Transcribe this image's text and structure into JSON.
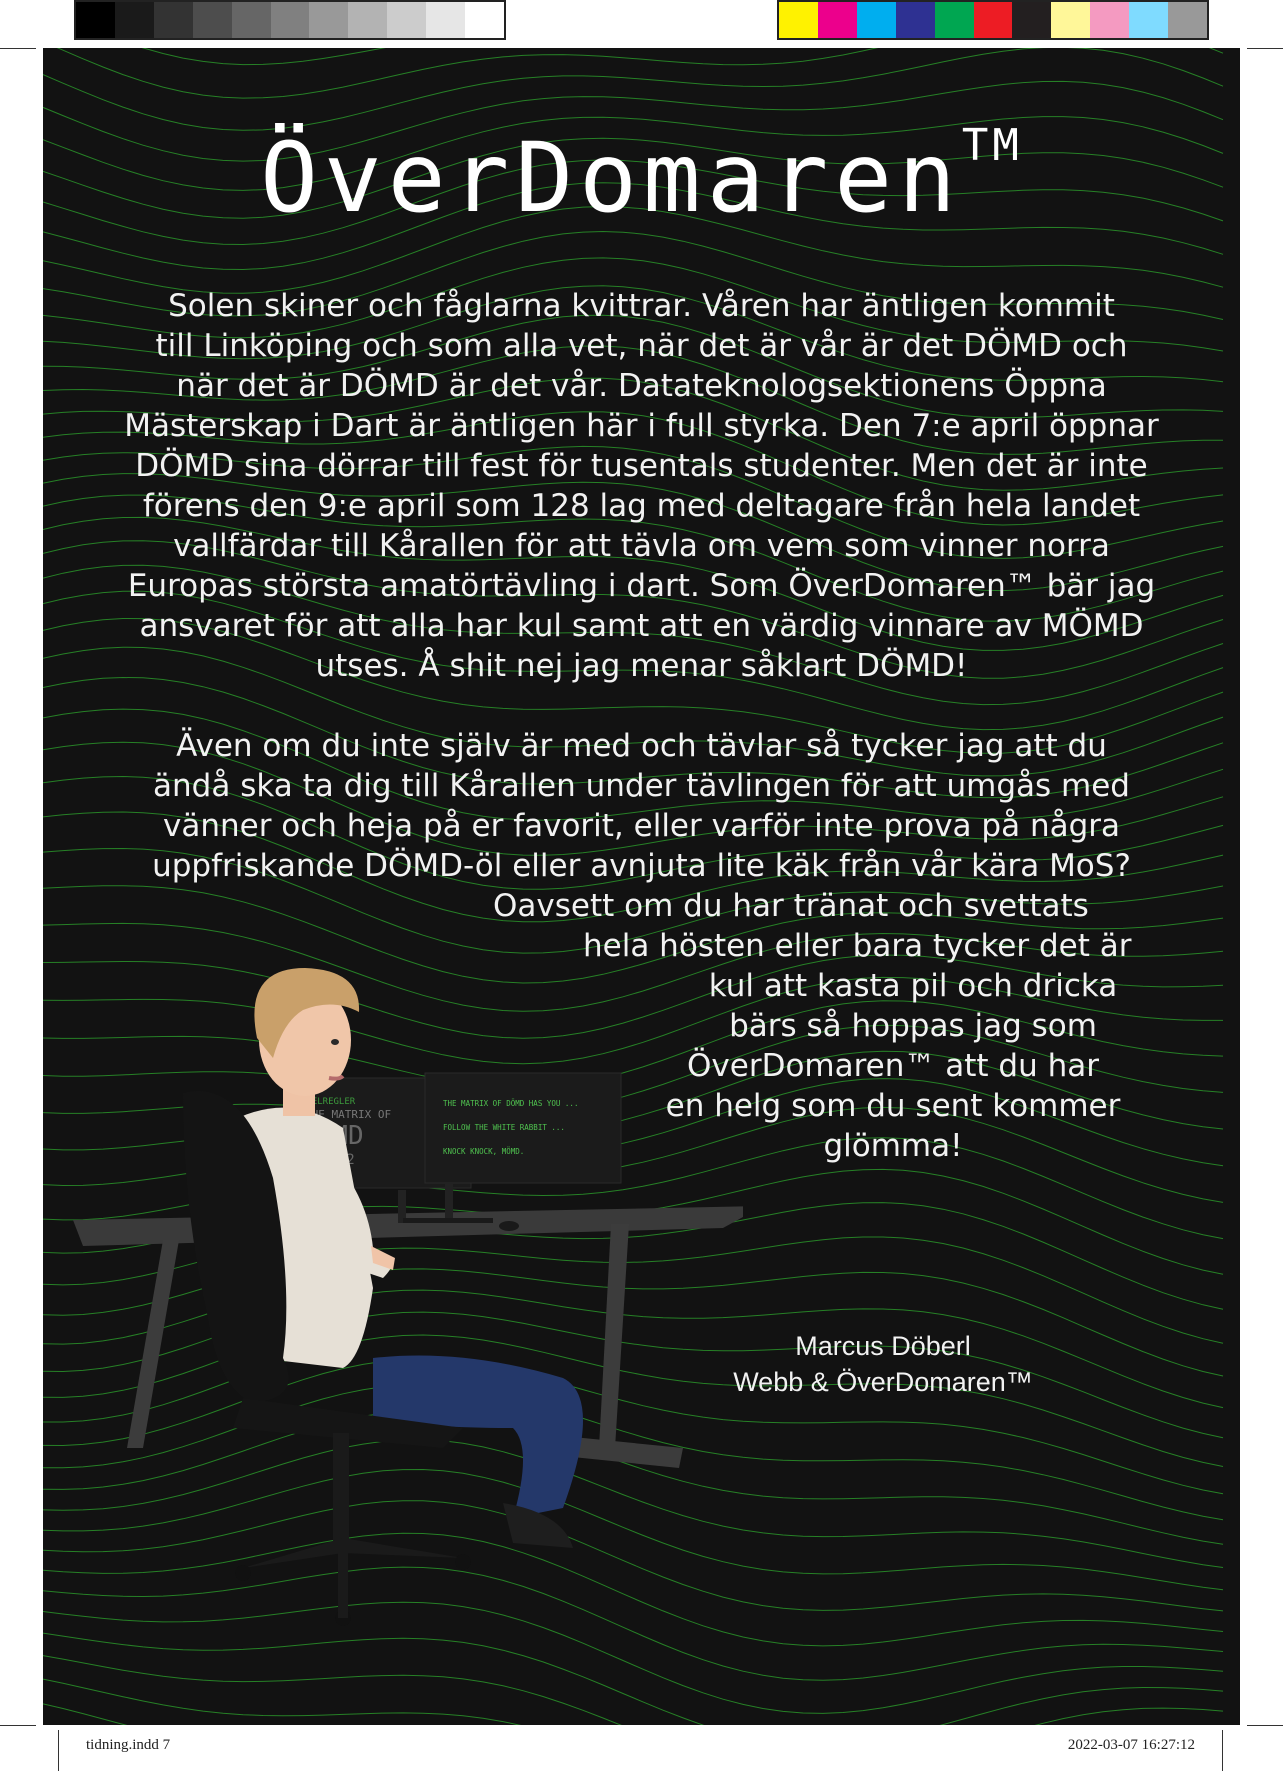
{
  "color_bars": {
    "grays": [
      "#000000",
      "#1a1a1a",
      "#333333",
      "#4d4d4d",
      "#666666",
      "#808080",
      "#999999",
      "#b3b3b3",
      "#cccccc",
      "#e6e6e6",
      "#ffffff"
    ],
    "colors": [
      "#fff200",
      "#ec008c",
      "#00aeef",
      "#2e3192",
      "#00a651",
      "#ed1c24",
      "#231f20",
      "#fff799",
      "#f49ac1",
      "#7fdbff",
      "#999999"
    ]
  },
  "page": {
    "background": "#121212",
    "line_color": "#2ea52e",
    "title": {
      "main": "ÖverDomaren",
      "mark": "TM"
    },
    "paragraph1": [
      "Solen skiner och fåglarna kvittrar. Våren har äntligen kommit",
      "till Linköping och som alla vet, när det är vår är det DÖMD och",
      "när det är DÖMD är det vår. Datateknologsektionens Öppna",
      "Mästerskap i Dart är äntligen här i full styrka. Den 7:e april öppnar",
      "DÖMD sina dörrar till fest för tusentals studenter. Men det är inte",
      "förens den 9:e april som 128 lag med deltagare från hela landet",
      "vallfärdar till Kårallen för att tävla om vem som vinner norra",
      "Europas största amatörtävling i dart. Som ÖverDomaren™ bär jag",
      "ansvaret för att alla har kul samt att en värdig vinnare av MÖMD",
      "utses. Å shit nej jag menar såklart DÖMD!"
    ],
    "paragraph2": [
      "Även om du inte själv är med och tävlar så tycker jag att du",
      "ändå ska ta dig till Kårallen under tävlingen för att umgås med",
      "vänner och heja på er favorit, eller varför inte prova på några",
      "uppfriskande DÖMD-öl eller avnjuta lite käk från vår kära MoS?"
    ],
    "paragraph3": [
      "Oavsett om du har tränat och svettats",
      "hela hösten eller bara tycker det är",
      "kul att kasta pil och dricka",
      "bärs så hoppas jag som",
      "ÖverDomaren™ att du har",
      "en helg som du sent kommer",
      "glömma!"
    ],
    "signature": {
      "name": "Marcus Döberl",
      "role": "Webb & ÖverDomaren™"
    },
    "illustration": {
      "monitor_left": [
        "SPELREGLER",
        "THE MATRIX OF",
        "DÖMD",
        "2022"
      ],
      "monitor_right": [
        "THE MATRIX OF DÖMD HAS YOU ...",
        "FOLLOW THE WHITE RABBIT ...",
        "KNOCK KNOCK, MÖMD."
      ]
    }
  },
  "footer": {
    "file": "tidning.indd   7",
    "timestamp": "2022-03-07   16:27:12"
  }
}
